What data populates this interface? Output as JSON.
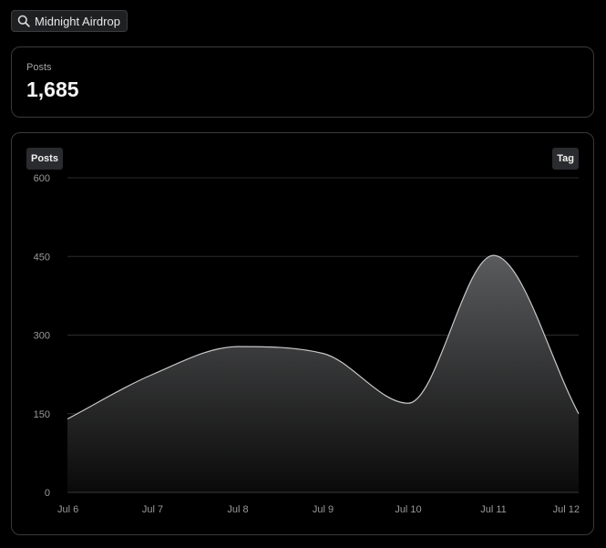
{
  "search": {
    "label": "Midnight Airdrop",
    "icon": "search-icon"
  },
  "stats": {
    "label": "Posts",
    "value": "1,685"
  },
  "chart_controls": {
    "left_label": "Posts",
    "right_label": "Tag"
  },
  "chart_data": {
    "type": "area",
    "title": "",
    "xlabel": "",
    "ylabel": "",
    "categories": [
      "Jul 6",
      "Jul 7",
      "Jul 8",
      "Jul 9",
      "Jul 10",
      "Jul 11",
      "Jul 12"
    ],
    "series": [
      {
        "values": [
          140,
          225,
          278,
          265,
          170,
          452,
          150
        ]
      }
    ],
    "ylim": [
      0,
      600
    ],
    "yticks": [
      "0",
      "150",
      "300",
      "450",
      "600"
    ],
    "grid": true,
    "colors": {
      "line": "#c8c8c8",
      "fill_top": "#5a5b5d",
      "fill_bottom": "#0a0a0a",
      "grid": "#2c2c2e"
    }
  }
}
